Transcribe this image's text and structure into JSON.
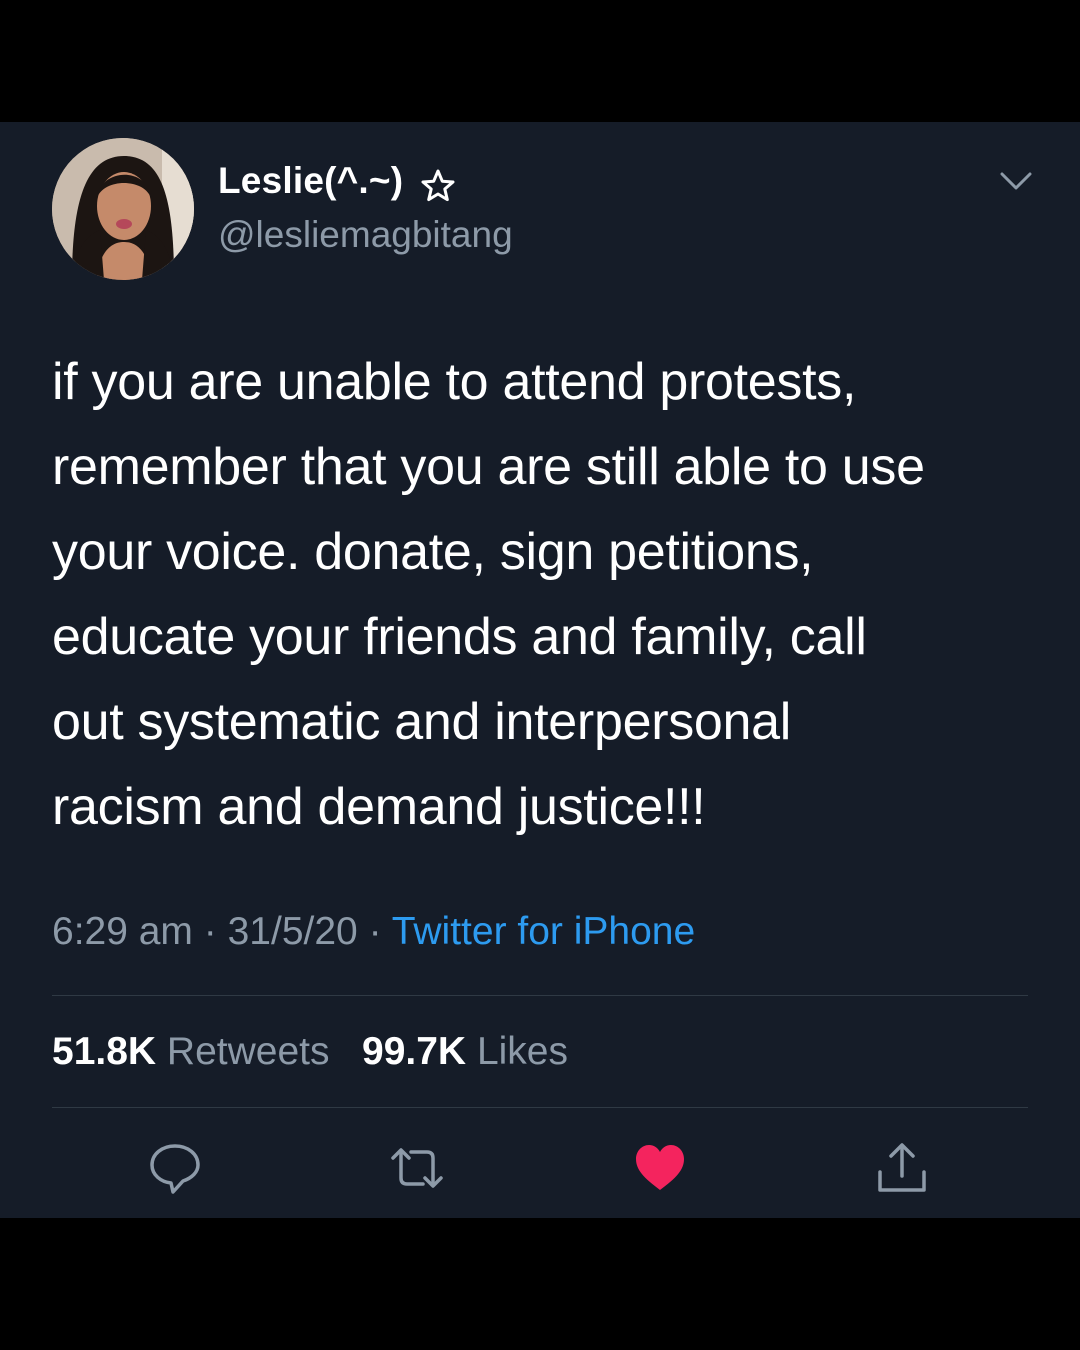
{
  "author": {
    "display_name": "Leslie(^.~)",
    "handle": "@lesliemagbitang"
  },
  "tweet": {
    "lines": [
      "if you are unable to attend protests,",
      "remember that you are still able to use",
      "your voice. donate, sign petitions,",
      "educate your friends and family, call",
      "out systematic and interpersonal",
      "racism and demand justice!!!"
    ],
    "time": "6:29 am",
    "date": "31/5/20",
    "separator": "·",
    "source": "Twitter for iPhone"
  },
  "stats": {
    "retweets_count": "51.8K",
    "retweets_label": "Retweets",
    "likes_count": "99.7K",
    "likes_label": "Likes"
  },
  "actions": {
    "reply_icon": "reply-bubble-icon",
    "retweet_icon": "retweet-icon",
    "like_icon": "heart-icon",
    "share_icon": "share-icon",
    "liked": true
  },
  "colors": {
    "background": "#151c28",
    "text": "#ffffff",
    "secondary": "#8d9aa8",
    "link": "#2d9bf0",
    "like": "#f4245e"
  }
}
